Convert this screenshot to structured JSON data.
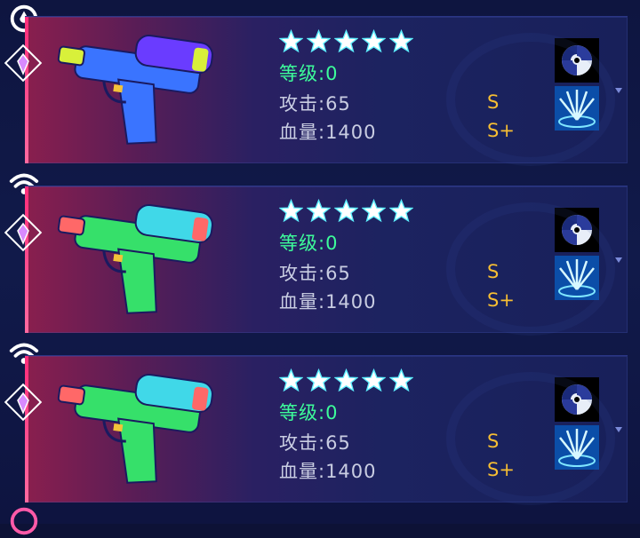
{
  "cards": [
    {
      "level_label": "等级:0",
      "attack_label": "攻击:65",
      "hp_label": "血量:1400",
      "grade_attack": "S",
      "grade_hp": "S+",
      "gun_color": "#3a74ff",
      "tank_color": "#6a3cff",
      "cap_color": "#d8f03a",
      "top_icon": "drop-icon"
    },
    {
      "level_label": "等级:0",
      "attack_label": "攻击:65",
      "hp_label": "血量:1400",
      "grade_attack": "S",
      "grade_hp": "S+",
      "gun_color": "#36e06a",
      "tank_color": "#40d8e8",
      "cap_color": "#ff6868",
      "top_icon": "wifi-icon"
    },
    {
      "level_label": "等级:0",
      "attack_label": "攻击:65",
      "hp_label": "血量:1400",
      "grade_attack": "S",
      "grade_hp": "S+",
      "gun_color": "#36e06a",
      "tank_color": "#40d8e8",
      "cap_color": "#ff6868",
      "top_icon": "wifi-icon"
    }
  ],
  "star_count": 5,
  "colors": {
    "level": "#3dfc9a",
    "stat": "#c9cde2",
    "grade": "#f6be33",
    "accent": "#ff2d7a"
  }
}
